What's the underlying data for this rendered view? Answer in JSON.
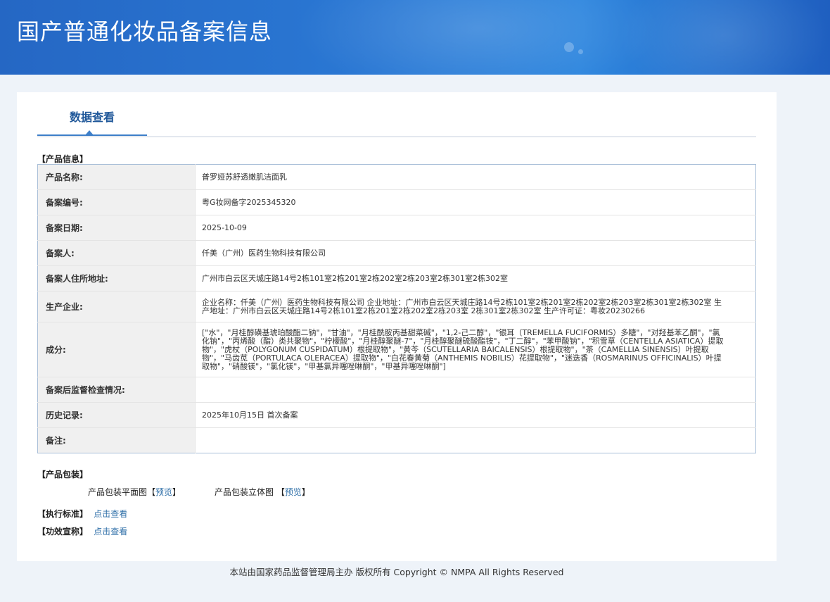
{
  "header": {
    "title": "国产普通化妆品备案信息"
  },
  "tabs": [
    {
      "label": "数据查看"
    }
  ],
  "product_info": {
    "section_label": "【产品信息】",
    "rows": [
      {
        "label": "产品名称:",
        "value": "普罗娅苏舒透嫩肌洁面乳"
      },
      {
        "label": "备案编号:",
        "value": "粤G妆网备字2025345320"
      },
      {
        "label": "备案日期:",
        "value": "2025-10-09"
      },
      {
        "label": "备案人:",
        "value": "仟美（广州）医药生物科技有限公司"
      },
      {
        "label": "备案人住所地址:",
        "value": "广州市白云区天城庄路14号2栋101室2栋201室2栋202室2栋203室2栋301室2栋302室"
      },
      {
        "label": "生产企业:",
        "value": "企业名称：仟美（广州）医药生物科技有限公司 企业地址：广州市白云区天城庄路14号2栋101室2栋201室2栋202室2栋203室2栋301室2栋302室 生产地址：广州市白云区天城庄路14号2栋101室2栋201室2栋202室2栋203室 2栋301室2栋302室 生产许可证：粤妆20230266"
      },
      {
        "label": "成分:",
        "value": "[\"水\"，\"月桂醇磺基琥珀酸酯二钠\"，\"甘油\"，\"月桂酰胺丙基甜菜碱\"，\"1,2-己二醇\"，\"银耳（TREMELLA FUCIFORMIS）多糖\"，\"对羟基苯乙酮\"，\"氯化钠\"，\"丙烯酸（酯）类共聚物\"，\"柠檬酸\"，\"月桂醇聚醚-7\"，\"月桂醇聚醚硫酸酯铵\"，\"丁二醇\"，\"苯甲酸钠\"，\"积雪草（CENTELLA ASIATICA）提取物\"，\"虎杖（POLYGONUM CUSPIDATUM）根提取物\"，\"黄芩（SCUTELLARIA BAICALENSIS）根提取物\"，\"茶（CAMELLIA SINENSIS）叶提取物\"，\"马齿苋（PORTULACA OLERACEA）提取物\"，\"白花春黄菊（ANTHEMIS NOBILIS）花提取物\"，\"迷迭香（ROSMARINUS OFFICINALIS）叶提取物\"，\"硝酸镁\"，\"氯化镁\"，\"甲基氯异噻唑啉酮\"，\"甲基异噻唑啉酮\"]"
      },
      {
        "label": "备案后监督检查情况:",
        "value": ""
      },
      {
        "label": "历史记录:",
        "value": "2025年10月15日 首次备案"
      },
      {
        "label": "备注:",
        "value": ""
      }
    ]
  },
  "packaging": {
    "section_label": "【产品包装】",
    "flat_label": "产品包装平面图",
    "flat_link": "预览",
    "solid_label": "产品包装立体图",
    "solid_link": "预览",
    "bracket_open": "【",
    "bracket_close": "】"
  },
  "standard": {
    "label": "【执行标准】",
    "link": "点击查看"
  },
  "efficacy": {
    "label": "【功效宣称】",
    "link": "点击查看"
  },
  "footer": {
    "text": "本站由国家药品监督管理局主办 版权所有 Copyright © NMPA All Rights Reserved"
  }
}
